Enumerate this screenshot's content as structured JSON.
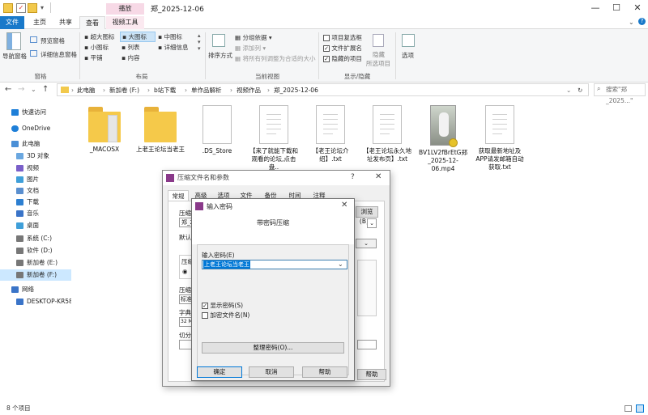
{
  "window": {
    "title": "郑_2025-12-06",
    "context_tab": "播放",
    "minimize": "—",
    "maximize": "☐",
    "close": "✕"
  },
  "ribbon_tabs": [
    "文件",
    "主页",
    "共享",
    "查看",
    "视频工具"
  ],
  "ribbon": {
    "nav_pane": "导航窗格",
    "preview_pane": "预览窗格",
    "details_pane": "详细信息窗格",
    "panes_group": "窗格",
    "layout_items": [
      "超大图标",
      "大图标",
      "中图标",
      "小图标",
      "列表",
      "详细信息",
      "平铺",
      "内容"
    ],
    "layout_group": "布局",
    "sort_by": "排序方式",
    "group_by": "分组依据",
    "add_column": "添加列",
    "fit_columns": "将所有列调整为合适的大小",
    "current_view_group": "当前视图",
    "item_checkboxes": "项目复选框",
    "file_extensions": "文件扩展名",
    "hidden_items": "隐藏的项目",
    "hide_selected": "隐藏",
    "hide_selected_2": "所选项目",
    "showhide_group": "显示/隐藏",
    "options": "选项"
  },
  "address": {
    "breadcrumb": [
      "此电脑",
      "新加卷 (F:)",
      "b站下载",
      "单作品解析",
      "视频作品",
      "郑_2025-12-06"
    ],
    "search_placeholder": "搜索\"郑_2025...\""
  },
  "nav_items": [
    {
      "label": "快速访问",
      "color": "#1e7fd8"
    },
    {
      "label": "OneDrive",
      "color": "#1e7fd8"
    },
    {
      "label": "此电脑",
      "color": "#4a8fd6"
    },
    {
      "label": "3D 对象",
      "color": "#6aa7e0"
    },
    {
      "label": "视频",
      "color": "#7a5fc9"
    },
    {
      "label": "图片",
      "color": "#3f9fd9"
    },
    {
      "label": "文档",
      "color": "#5a8fcf"
    },
    {
      "label": "下载",
      "color": "#2d7fd1"
    },
    {
      "label": "音乐",
      "color": "#3a74c8"
    },
    {
      "label": "桌面",
      "color": "#3f9fd9"
    },
    {
      "label": "系统 (C:)",
      "color": "#777777"
    },
    {
      "label": "软件 (D:)",
      "color": "#777777"
    },
    {
      "label": "新加卷 (E:)",
      "color": "#777777"
    },
    {
      "label": "新加卷 (F:)",
      "color": "#777777"
    },
    {
      "label": "网络",
      "color": "#3a74c8"
    },
    {
      "label": "DESKTOP-KR58",
      "color": "#3a74c8"
    }
  ],
  "files": [
    {
      "name": "_MACOSX",
      "kind": "folder"
    },
    {
      "name": "上老王论坛当老王",
      "kind": "folder"
    },
    {
      "name": ".DS_Store",
      "kind": "doc"
    },
    {
      "name": "【来了就能下载和观看的论坛,点击盘..",
      "kind": "doc"
    },
    {
      "name": "【老王论坛介绍】.txt",
      "kind": "doc"
    },
    {
      "name": "【老王论坛永久地址发布页】.txt",
      "kind": "doc"
    },
    {
      "name": "BV1LV2fBrEtG郑_2025-12-06.mp4",
      "kind": "video"
    },
    {
      "name": "获取最新地址及APP请发邮箱自动获取.txt",
      "kind": "doc"
    }
  ],
  "status": "8 个项目",
  "archive_dialog": {
    "title": "压缩文件名和参数",
    "help": "?",
    "tabs": [
      "常规",
      "高级",
      "选项",
      "文件",
      "备份",
      "时间",
      "注释"
    ],
    "filename_label": "压缩",
    "filename_value": "郑_2",
    "browse_btn": "浏览(B)...",
    "default_label": "默认配",
    "format_label": "压缩",
    "method_label": "压缩方",
    "method_value": "标准",
    "dict_label": "字典大",
    "dict_value": "32 MB",
    "split_label": "切分为",
    "help_btn": "帮助"
  },
  "password_dialog": {
    "title": "输入密码",
    "heading": "带密码压缩",
    "input_label": "输入密码(E)",
    "password_value": "上老王论坛当老王",
    "show_password": "显示密码(S)",
    "encrypt_names": "加密文件名(N)",
    "organize_btn": "整理密码(O)...",
    "ok": "确定",
    "cancel": "取消",
    "help": "帮助"
  }
}
